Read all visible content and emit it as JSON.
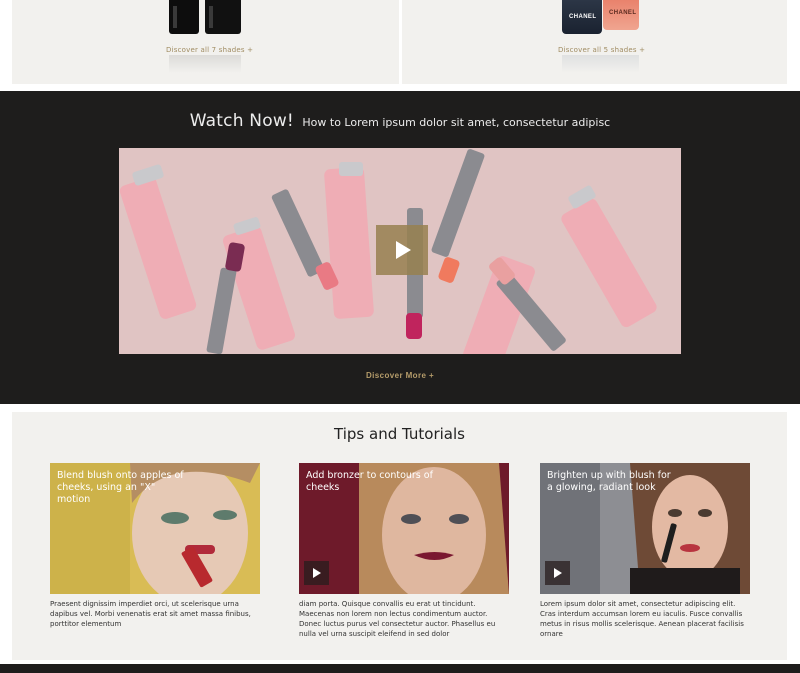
{
  "top": {
    "left_link": "Discover all 7 shades +",
    "right_link": "Discover all 5 shades +",
    "brand_label": "CHANEL"
  },
  "watch": {
    "title_big": "Watch Now!",
    "title_small": "How to Lorem ipsum dolor sit amet, consectetur adipisc",
    "cta": "Discover More +"
  },
  "tips": {
    "title": "Tips and Tutorials",
    "cards": [
      {
        "caption": "Blend blush onto apples of cheeks, using an \"X\" motion",
        "description": "Praesent dignissim imperdiet orci, ut scelerisque urna dapibus vel. Morbi venenatis erat sit amet massa finibus, porttitor elementum"
      },
      {
        "caption": "Add bronzer to contours of cheeks",
        "description": "diam porta. Quisque convallis eu erat ut tincidunt. Maecenas non lorem non lectus condimentum auctor. Donec luctus purus vel consectetur auctor. Phasellus eu nulla vel urna suscipit eleifend in sed dolor"
      },
      {
        "caption": "Brighten up with blush for a glowing, radiant look",
        "description": "Lorem ipsum dolor sit amet, consectetur adipiscing elit. Cras interdum accumsan lorem eu iaculis. Fusce convallis metus in risus mollis scelerisque. Aenean placerat facilisis ornare"
      }
    ]
  },
  "colors": {
    "dark_band": "#1e1d1c",
    "panel": "#f2f1ee",
    "gold_accent": "#b59c6a"
  },
  "icons": [
    "play-icon"
  ]
}
